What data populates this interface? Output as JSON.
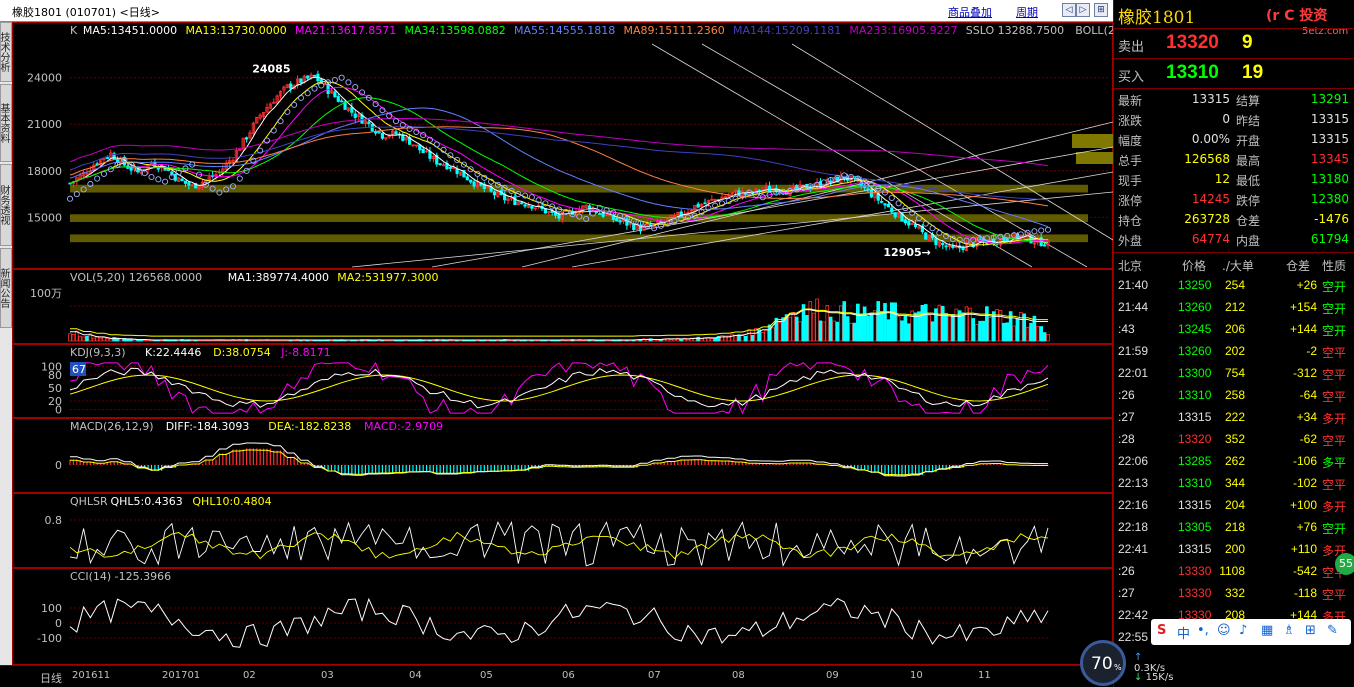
{
  "window": {
    "title": "橡胶1801 (010701) <日线>",
    "buttons": [
      "商品叠加",
      "周期"
    ],
    "icons": [
      "prev-icon",
      "next-icon",
      "zoom-icon",
      "close-icon"
    ]
  },
  "left_tabs": [
    "技术分析",
    "基本资料",
    "财务透视",
    "新闻公告"
  ],
  "colors": {
    "up": "#ff3030",
    "down": "#00ffff",
    "neutral": "#e0e0e0",
    "ma5": "#ffffff",
    "ma13": "#ffff00",
    "ma21": "#ff00ff",
    "ma34": "#00ff00",
    "ma55": "#6080ff",
    "ma89": "#ff8040",
    "ma144": "#4040c0",
    "ma233": "#c000c0",
    "band": "#807800"
  },
  "main_panel": {
    "legend": [
      {
        "text": "K",
        "color": "#c0c0c0"
      },
      {
        "text": "MA5:13451.0000",
        "color": "#ffffff"
      },
      {
        "text": "MA13:13730.0000",
        "color": "#ffff00"
      },
      {
        "text": "MA21:13617.8571",
        "color": "#ff00ff"
      },
      {
        "text": "MA34:13598.0882",
        "color": "#00ff00"
      },
      {
        "text": "MA55:14555.1818",
        "color": "#6080ff"
      },
      {
        "text": "MA89:15111.2360",
        "color": "#ff8040"
      },
      {
        "text": "MA144:15209.1181",
        "color": "#4040c0"
      },
      {
        "text": "MA233:16905.9227",
        "color": "#c000c0"
      },
      {
        "text": "SSLO 13288.7500",
        "color": "#c0c0c0"
      },
      {
        "text": "BOLL(26,2",
        "color": "#c0c0c0"
      }
    ],
    "annotations": {
      "high": "24085",
      "low": "12905"
    }
  },
  "vol_panel": {
    "legend": [
      {
        "text": "VOL(5,20)  126568.0000",
        "color": "#c0c0c0"
      },
      {
        "text": "MA1:389774.4000",
        "color": "#ffffff"
      },
      {
        "text": "MA2:531977.3000",
        "color": "#ffff00"
      }
    ]
  },
  "kdj_panel": {
    "legend": [
      {
        "text": "KDJ(9,3,3)",
        "color": "#c0c0c0"
      },
      {
        "text": "K:22.4446",
        "color": "#ffffff"
      },
      {
        "text": "D:38.0754",
        "color": "#ffff00"
      },
      {
        "text": "J:-8.8171",
        "color": "#ff00ff"
      }
    ],
    "badge": "67"
  },
  "macd_panel": {
    "legend": [
      {
        "text": "MACD(26,12,9)",
        "color": "#c0c0c0"
      },
      {
        "text": "DIFF:-184.3093",
        "color": "#ffffff"
      },
      {
        "text": "DEA:-182.8238",
        "color": "#ffff00"
      },
      {
        "text": "MACD:-2.9709",
        "color": "#ff00ff"
      }
    ]
  },
  "qhlsr_panel": {
    "legend": [
      {
        "text": "QHLSR",
        "color": "#c0c0c0"
      },
      {
        "text": "QHL5:0.4363",
        "color": "#ffffff"
      },
      {
        "text": "QHL10:0.4804",
        "color": "#ffff00"
      }
    ]
  },
  "cci_panel": {
    "legend": [
      {
        "text": "CCI(14)  -125.3966",
        "color": "#c0c0c0"
      }
    ]
  },
  "bottom_bar": {
    "label": "日线"
  },
  "chart_data": [
    {
      "type": "candlestick",
      "title": "橡胶1801 (010701) <日线>",
      "x_ticks": [
        "201611",
        "201701",
        "02",
        "03",
        "04",
        "05",
        "06",
        "07",
        "08",
        "09",
        "10",
        "11"
      ],
      "y_ticks": [
        24000,
        21000,
        18000,
        15000
      ],
      "ylim": [
        11800,
        26300
      ],
      "close_path": [
        17200,
        17800,
        18600,
        19100,
        18400,
        17900,
        18500,
        18200,
        17400,
        17000,
        17400,
        17900,
        18900,
        20200,
        21600,
        22600,
        23400,
        23800,
        24085,
        23200,
        22400,
        21600,
        21000,
        20300,
        20400,
        19900,
        19200,
        18600,
        18300,
        17700,
        17100,
        16600,
        16200,
        16000,
        15800,
        15400,
        15000,
        15400,
        15700,
        15300,
        14900,
        14600,
        14300,
        14500,
        14800,
        15200,
        15700,
        16000,
        16300,
        16600,
        16500,
        16800,
        16900,
        16700,
        16900,
        17100,
        17300,
        17600,
        17200,
        16500,
        15800,
        15100,
        14500,
        13800,
        13300,
        12905,
        13200,
        13400,
        13500,
        13650,
        13800,
        13500,
        13315
      ],
      "sar_path": [
        16200,
        16800,
        17500,
        18100,
        18700,
        18100,
        17600,
        17300,
        17900,
        18400,
        17100,
        16600,
        17000,
        18000,
        19300,
        20600,
        21800,
        22700,
        23300,
        23700,
        24000,
        23400,
        22700,
        21900,
        21200,
        20700,
        20300,
        19700,
        19000,
        18400,
        17800,
        17300,
        16900,
        16500,
        16300,
        15900,
        15500,
        15200,
        14900,
        15600,
        15300,
        14900,
        14600,
        14300,
        14600,
        14900,
        15100,
        15600,
        15900,
        16200,
        16600,
        16300,
        16600,
        16700,
        16900,
        17100,
        17400,
        17700,
        17500,
        17100,
        16600,
        15900,
        15300,
        14600,
        14000,
        13600,
        13500,
        13600,
        13700,
        13800,
        13900,
        14100,
        14200
      ],
      "resistance_bands": [
        [
          16600,
          17100
        ],
        [
          14700,
          15200
        ],
        [
          13400,
          13900
        ]
      ],
      "high_label": 24085,
      "low_label": 12905
    },
    {
      "type": "bar",
      "title": "VOL(5,20)",
      "y_ticks_label": "100万",
      "volume_profile": [
        0.18,
        0.12,
        0.08,
        0.05,
        0.04,
        0.03,
        0.02,
        0.02,
        0.02,
        0.02,
        0.02,
        0.02,
        0.02,
        0.02,
        0.02,
        0.02,
        0.02,
        0.02,
        0.02,
        0.02,
        0.02,
        0.02,
        0.02,
        0.02,
        0.02,
        0.02,
        0.02,
        0.02,
        0.02,
        0.02,
        0.02,
        0.02,
        0.02,
        0.02,
        0.02,
        0.02,
        0.02,
        0.02,
        0.02,
        0.02,
        0.02,
        0.02,
        0.03,
        0.03,
        0.04,
        0.04,
        0.05,
        0.06,
        0.08,
        0.11,
        0.15,
        0.22,
        0.38,
        0.52,
        0.61,
        0.58,
        0.55,
        0.53,
        0.5,
        0.52,
        0.55,
        0.5,
        0.48,
        0.52,
        0.5,
        0.48,
        0.52,
        0.5,
        0.48,
        0.45,
        0.42,
        0.38,
        0.1
      ]
    },
    {
      "type": "line",
      "title": "KDJ(9,3,3)",
      "y_ticks": [
        100,
        80,
        50,
        20,
        0
      ],
      "ylim": [
        -10,
        110
      ]
    },
    {
      "type": "bar",
      "title": "MACD(26,12,9)",
      "y_ticks": [
        0
      ]
    },
    {
      "type": "line",
      "title": "QHLSR",
      "y_ticks": [
        0.8
      ]
    },
    {
      "type": "line",
      "title": "CCI(14)",
      "y_ticks": [
        100,
        0,
        -100
      ],
      "ylim": [
        -260,
        260
      ]
    }
  ],
  "quote_panel": {
    "title": "橡胶1801",
    "logo": "(r",
    "logo_text": "C 投资",
    "logo_sub": "5etz.com",
    "sell": {
      "label": "卖出",
      "price": "13320",
      "vol": "9"
    },
    "buy": {
      "label": "买入",
      "price": "13310",
      "vol": "19"
    },
    "stats": [
      {
        "l1": "最新",
        "v1": "13315",
        "c1": "#e0e0e0",
        "l2": "结算",
        "v2": "13291",
        "c2": "#00ff00"
      },
      {
        "l1": "涨跌",
        "v1": "0",
        "c1": "#e0e0e0",
        "l2": "昨结",
        "v2": "13315",
        "c2": "#e0e0e0"
      },
      {
        "l1": "幅度",
        "v1": "0.00%",
        "c1": "#e0e0e0",
        "l2": "开盘",
        "v2": "13315",
        "c2": "#e0e0e0"
      },
      {
        "l1": "总手",
        "v1": "126568",
        "c1": "#ffff00",
        "l2": "最高",
        "v2": "13345",
        "c2": "#ff3030"
      },
      {
        "l1": "现手",
        "v1": "12",
        "c1": "#ffff00",
        "l2": "最低",
        "v2": "13180",
        "c2": "#00ff00"
      },
      {
        "l1": "涨停",
        "v1": "14245",
        "c1": "#ff3030",
        "l2": "跌停",
        "v2": "12380",
        "c2": "#00ff00"
      },
      {
        "l1": "持仓",
        "v1": "263728",
        "c1": "#ffff00",
        "l2": "仓差",
        "v2": "-1476",
        "c2": "#ffff00"
      },
      {
        "l1": "外盘",
        "v1": "64774",
        "c1": "#ff3030",
        "l2": "内盘",
        "v2": "61794",
        "c2": "#00ff00"
      }
    ],
    "tick_header": [
      "北京",
      "价格",
      "./大单",
      "仓差",
      "性质"
    ],
    "ticks": [
      {
        "t": "21:40",
        "p": "13250",
        "pc": "#00ff00",
        "v": "254",
        "d": "+26",
        "dc": "#ffff00",
        "n": "空开",
        "nc": "#00ff00"
      },
      {
        "t": "21:44",
        "p": "13260",
        "pc": "#00ff00",
        "v": "212",
        "d": "+154",
        "dc": "#ffff00",
        "n": "空开",
        "nc": "#00ff00"
      },
      {
        "t": ":43",
        "p": "13245",
        "pc": "#00ff00",
        "v": "206",
        "d": "+144",
        "dc": "#ffff00",
        "n": "空开",
        "nc": "#00ff00"
      },
      {
        "t": "21:59",
        "p": "13260",
        "pc": "#00ff00",
        "v": "202",
        "d": "-2",
        "dc": "#ffff00",
        "n": "空平",
        "nc": "#ff3030"
      },
      {
        "t": "22:01",
        "p": "13300",
        "pc": "#00ff00",
        "v": "754",
        "d": "-312",
        "dc": "#ffff00",
        "n": "空平",
        "nc": "#ff3030"
      },
      {
        "t": ":26",
        "p": "13310",
        "pc": "#00ff00",
        "v": "258",
        "d": "-64",
        "dc": "#ffff00",
        "n": "空平",
        "nc": "#ff3030"
      },
      {
        "t": ":27",
        "p": "13315",
        "pc": "#e0e0e0",
        "v": "222",
        "d": "+34",
        "dc": "#ffff00",
        "n": "多开",
        "nc": "#ff3030"
      },
      {
        "t": ":28",
        "p": "13320",
        "pc": "#ff3030",
        "v": "352",
        "d": "-62",
        "dc": "#ffff00",
        "n": "空平",
        "nc": "#ff3030"
      },
      {
        "t": "22:06",
        "p": "13285",
        "pc": "#00ff00",
        "v": "262",
        "d": "-106",
        "dc": "#ffff00",
        "n": "多平",
        "nc": "#00ff00"
      },
      {
        "t": "22:13",
        "p": "13310",
        "pc": "#00ff00",
        "v": "344",
        "d": "-102",
        "dc": "#ffff00",
        "n": "空平",
        "nc": "#ff3030"
      },
      {
        "t": "22:16",
        "p": "13315",
        "pc": "#e0e0e0",
        "v": "204",
        "d": "+100",
        "dc": "#ffff00",
        "n": "多开",
        "nc": "#ff3030"
      },
      {
        "t": "22:18",
        "p": "13305",
        "pc": "#00ff00",
        "v": "218",
        "d": "+76",
        "dc": "#ffff00",
        "n": "空开",
        "nc": "#00ff00"
      },
      {
        "t": "22:41",
        "p": "13315",
        "pc": "#e0e0e0",
        "v": "200",
        "d": "+110",
        "dc": "#ffff00",
        "n": "多开",
        "nc": "#ff3030"
      },
      {
        "t": ":26",
        "p": "13330",
        "pc": "#ff3030",
        "v": "1108",
        "d": "-542",
        "dc": "#ffff00",
        "n": "空平",
        "nc": "#ff3030"
      },
      {
        "t": ":27",
        "p": "13330",
        "pc": "#ff3030",
        "v": "332",
        "d": "-118",
        "dc": "#ffff00",
        "n": "空平",
        "nc": "#ff3030"
      },
      {
        "t": "22:42",
        "p": "13330",
        "pc": "#ff3030",
        "v": "208",
        "d": "+144",
        "dc": "#ffff00",
        "n": "多开",
        "nc": "#ff3030"
      },
      {
        "t": "22:55",
        "p": "",
        "pc": "#ff3030",
        "v": "",
        "d": "",
        "dc": "#ffff00",
        "n": "",
        "nc": "#ff3030"
      }
    ]
  },
  "ime_bar": {
    "text": "中",
    "icons": [
      "punct-icon",
      "emoji-icon",
      "mic-icon",
      "keyboard-icon",
      "shirt-icon",
      "grid-icon",
      "wrench-icon"
    ]
  },
  "net_speed": {
    "percent": "70",
    "suffix": "%",
    "up": "0.3K/s",
    "down": "15K/s"
  },
  "side_badge": "55"
}
